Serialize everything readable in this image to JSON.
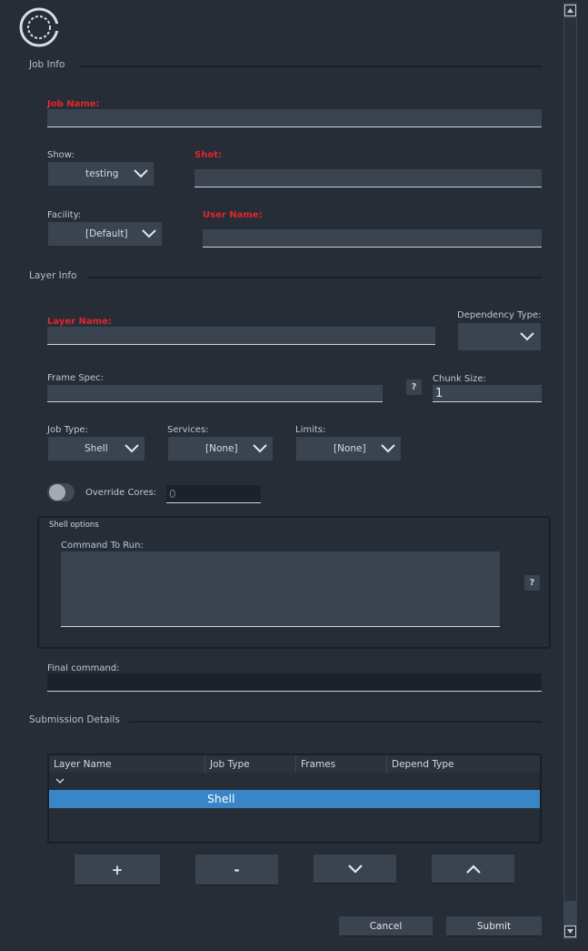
{
  "job_info": {
    "section_title": "Job Info",
    "job_name": {
      "label": "Job Name:",
      "value": ""
    },
    "show": {
      "label": "Show:",
      "selected": "testing"
    },
    "shot": {
      "label": "Shot:",
      "value": ""
    },
    "facility": {
      "label": "Facility:",
      "selected": "[Default]"
    },
    "user_name": {
      "label": "User Name:",
      "value": ""
    }
  },
  "layer_info": {
    "section_title": "Layer Info",
    "layer_name": {
      "label": "Layer Name:",
      "value": ""
    },
    "dependency_type": {
      "label": "Dependency Type:",
      "selected": ""
    },
    "frame_spec": {
      "label": "Frame Spec:",
      "value": ""
    },
    "frame_spec_help": "?",
    "chunk_size": {
      "label": "Chunk Size:",
      "value": "1"
    },
    "job_type": {
      "label": "Job Type:",
      "selected": "Shell"
    },
    "services": {
      "label": "Services:",
      "selected": "[None]"
    },
    "limits": {
      "label": "Limits:",
      "selected": "[None]"
    },
    "override_cores": {
      "label": "Override Cores:",
      "placeholder": "0",
      "enabled": false
    }
  },
  "shell_options": {
    "title": "Shell options",
    "command_label": "Command To Run:",
    "command_value": "",
    "help": "?"
  },
  "final_command": {
    "label": "Final command:",
    "value": ""
  },
  "submission": {
    "section_title": "Submission Details",
    "columns": [
      "Layer Name",
      "Job Type",
      "Frames",
      "Depend Type"
    ],
    "rows": [
      {
        "layer_name": "",
        "job_type": "Shell",
        "frames": "",
        "depend_type": ""
      }
    ],
    "add_label": "+",
    "remove_label": "-"
  },
  "actions": {
    "cancel": "Cancel",
    "submit": "Submit"
  },
  "colors": {
    "background": "#262d37",
    "required_label": "#e0262d",
    "selection": "#3886c8",
    "field": "#3a4350"
  },
  "icons": [
    "app-logo-icon",
    "chevron-down-icon",
    "chevron-up-icon",
    "toggle-switch"
  ]
}
